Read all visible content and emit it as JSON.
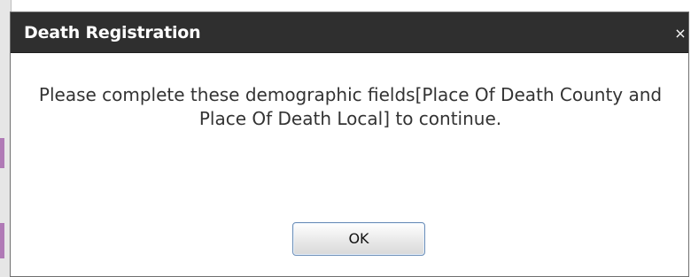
{
  "dialog": {
    "title": "Death Registration",
    "close_glyph": "×",
    "message": "Please complete these demographic fields[Place Of Death County and Place Of Death Local] to continue.",
    "ok_label": "OK"
  },
  "colors": {
    "titlebar": "#2f2f2f",
    "title_text": "#ffffff",
    "message_text": "#333333",
    "button_border": "#6d8fb8",
    "accent": "#b07ab6"
  }
}
